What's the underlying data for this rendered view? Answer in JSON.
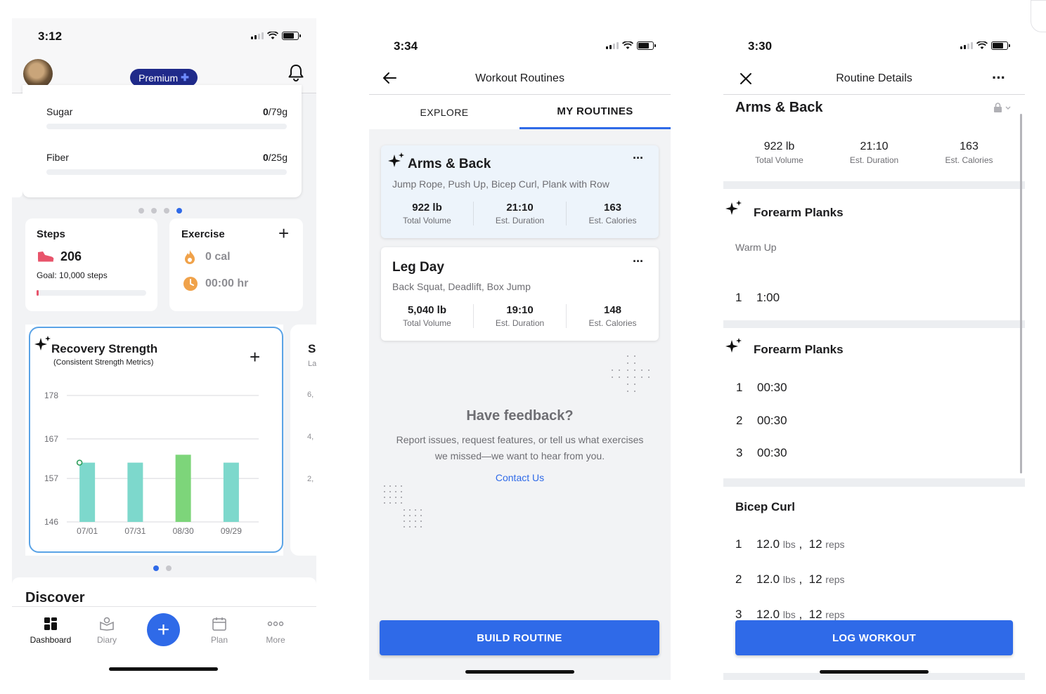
{
  "screen1": {
    "status_time": "3:12",
    "premium_label": "Premium",
    "nutrients": [
      {
        "label": "Sugar",
        "value": "0",
        "goal": "/79g"
      },
      {
        "label": "Fiber",
        "value": "0",
        "goal": "/25g"
      }
    ],
    "steps": {
      "title": "Steps",
      "count": "206",
      "goal": "Goal: 10,000 steps",
      "progress": 0.02
    },
    "exercise": {
      "title": "Exercise",
      "calories": "0 cal",
      "duration": "00:00 hr"
    },
    "recovery": {
      "title": "Recovery Strength",
      "subtitle": "(Consistent Strength Metrics)",
      "peek_title": "S",
      "peek_sub": "La",
      "peek_ticks": [
        "6,",
        "4,",
        "2,"
      ]
    },
    "discover_label": "Discover",
    "nav": [
      {
        "label": "Dashboard",
        "icon": "dashboard-icon"
      },
      {
        "label": "Diary",
        "icon": "diary-icon"
      },
      {
        "label": "",
        "icon": "plus-icon"
      },
      {
        "label": "Plan",
        "icon": "calendar-icon"
      },
      {
        "label": "More",
        "icon": "more-icon"
      }
    ],
    "colors": {
      "accent": "#2f6ae8",
      "premium_bg": "#1f2a8a",
      "bar_teal": "#7dd8cc",
      "bar_green": "#7dd57a"
    }
  },
  "chart_data": {
    "type": "bar",
    "title": "Recovery Strength",
    "subtitle": "(Consistent Strength Metrics)",
    "categories": [
      "07/01",
      "07/31",
      "08/30",
      "09/29"
    ],
    "values": [
      161,
      161,
      163,
      161
    ],
    "highlight_index": 2,
    "y_ticks": [
      178,
      167,
      157,
      146
    ],
    "ylim": [
      146,
      178
    ],
    "grid": true
  },
  "screen2": {
    "status_time": "3:34",
    "title": "Workout Routines",
    "tabs": [
      {
        "label": "EXPLORE",
        "active": false
      },
      {
        "label": "MY ROUTINES",
        "active": true
      }
    ],
    "routines": [
      {
        "name": "Arms & Back",
        "exercises": "Jump Rope, Push Up, Bicep Curl, Plank with Row",
        "stats": [
          {
            "value": "922 lb",
            "label": "Total Volume"
          },
          {
            "value": "21:10",
            "label": "Est. Duration"
          },
          {
            "value": "163",
            "label": "Est. Calories"
          }
        ]
      },
      {
        "name": "Leg Day",
        "exercises": "Back Squat, Deadlift, Box Jump",
        "stats": [
          {
            "value": "5,040 lb",
            "label": "Total Volume"
          },
          {
            "value": "19:10",
            "label": "Est. Duration"
          },
          {
            "value": "148",
            "label": "Est. Calories"
          }
        ]
      }
    ],
    "feedback_title": "Have feedback?",
    "feedback_text_1": "Report issues, request features, or tell us what exercises",
    "feedback_text_2": "we missed—we want to hear from you.",
    "contact_label": "Contact Us",
    "build_label": "BUILD ROUTINE"
  },
  "screen3": {
    "status_time": "3:30",
    "title": "Routine Details",
    "routine_name": "Arms & Back",
    "stats": [
      {
        "value": "922 lb",
        "label": "Total Volume"
      },
      {
        "value": "21:10",
        "label": "Est. Duration"
      },
      {
        "value": "163",
        "label": "Est. Calories"
      }
    ],
    "sections": [
      {
        "title": "Forearm Planks",
        "note": "Warm Up",
        "sets": [
          {
            "n": "1",
            "v": "1:00"
          }
        ]
      },
      {
        "title": "Forearm Planks",
        "sets": [
          {
            "n": "1",
            "v": "00:30"
          },
          {
            "n": "2",
            "v": "00:30"
          },
          {
            "n": "3",
            "v": "00:30"
          }
        ]
      },
      {
        "title": "Bicep Curl",
        "sets": [
          {
            "n": "1",
            "w": "12.0",
            "wu": "lbs",
            "r": "12",
            "ru": "reps"
          },
          {
            "n": "2",
            "w": "12.0",
            "wu": "lbs",
            "r": "12",
            "ru": "reps"
          },
          {
            "n": "3",
            "w": "12.0",
            "wu": "lbs",
            "r": "12",
            "ru": "reps"
          }
        ]
      }
    ],
    "log_label": "LOG WORKOUT"
  }
}
